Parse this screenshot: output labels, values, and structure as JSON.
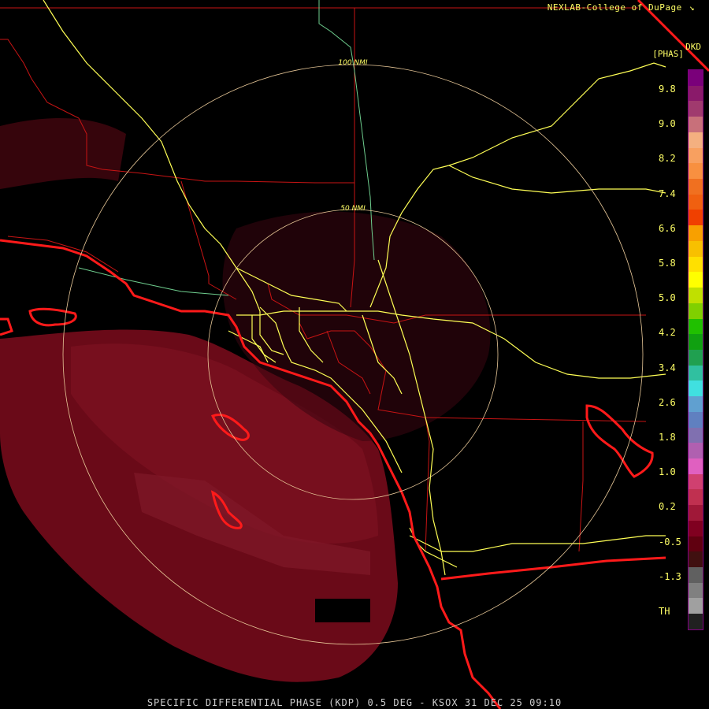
{
  "header": {
    "credit": "NEXLAB-College of DuPage",
    "credit_icon": "arrow-logo-icon",
    "product_code": "DKD",
    "unit_label": "[PHAS]"
  },
  "footer": {
    "title": "SPECIFIC DIFFERENTIAL PHASE (KDP) 0.5 DEG - KSOX 31 DEC 25 09:10"
  },
  "map": {
    "range_rings": [
      "50 NMI",
      "100 NMI"
    ],
    "colors": {
      "coastline": "#ff1a1a",
      "boundaries": "#c81414",
      "highways": "#ffff55",
      "rivers": "#6fcf8f",
      "range_rings": "#e8c898",
      "echo_base": "#6a0a18"
    }
  },
  "legend": {
    "ticks": [
      "9.8",
      "9.0",
      "8.2",
      "7.4",
      "6.6",
      "5.8",
      "5.0",
      "4.2",
      "3.4",
      "2.6",
      "1.8",
      "1.0",
      "0.2",
      "-0.5",
      "-1.3",
      "TH"
    ],
    "colors": [
      "#7a007a",
      "#8a1a6a",
      "#a03a6e",
      "#c8707a",
      "#f4b080",
      "#f8a060",
      "#f89040",
      "#f07020",
      "#f06010",
      "#f04000",
      "#f8a000",
      "#f8c000",
      "#ffe000",
      "#ffff00",
      "#c0e000",
      "#80d000",
      "#20c000",
      "#10a010",
      "#20a050",
      "#30c0a0",
      "#40e0e0",
      "#60a0d0",
      "#6080c0",
      "#8070b0",
      "#b060b0",
      "#e060c0",
      "#d04070",
      "#c03050",
      "#a01838",
      "#800020",
      "#600010",
      "#401010",
      "#606060",
      "#808080",
      "#a0a0a0",
      "#202020"
    ]
  }
}
